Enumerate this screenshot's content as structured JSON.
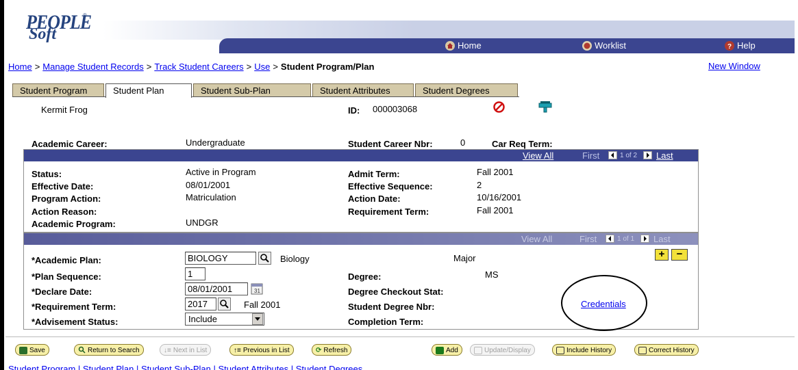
{
  "header": {
    "logo_top": "PEOPLE",
    "logo_bottom": "Soft",
    "logo_mark": "®",
    "nav": [
      {
        "label": "Home",
        "icon": "home-icon",
        "color": "#c0392b"
      },
      {
        "label": "Worklist",
        "icon": "worklist-icon",
        "color": "#c0392b"
      },
      {
        "label": "Help",
        "icon": "help-icon",
        "color": "#c0392b"
      }
    ]
  },
  "breadcrumb": {
    "items": [
      "Home",
      "Manage Student Records",
      "Track Student Careers",
      "Use"
    ],
    "current": "Student Program/Plan",
    "separator": ">"
  },
  "new_window": "New Window",
  "tabs": [
    {
      "label": "Student Program",
      "active": false
    },
    {
      "label": "Student Plan",
      "active": true
    },
    {
      "label": "Student Sub-Plan",
      "active": false
    },
    {
      "label": "Student Attributes",
      "active": false
    },
    {
      "label": "Student Degrees",
      "active": false
    }
  ],
  "student": {
    "name": "Kermit Frog",
    "id_label": "ID:",
    "id_value": "000003068"
  },
  "career": {
    "academic_career_label": "Academic Career:",
    "academic_career_value": "Undergraduate",
    "career_nbr_label": "Student Career Nbr:",
    "career_nbr_value": "0",
    "car_req_term_label": "Car Req Term:"
  },
  "program_bar": {
    "view_all": "View All",
    "first": "First",
    "range": "1 of 2",
    "last": "Last"
  },
  "program": {
    "status_label": "Status:",
    "status_value": "Active in Program",
    "effdate_label": "Effective Date:",
    "effdate_value": "08/01/2001",
    "action_label": "Program Action:",
    "action_value": "Matriculation",
    "reason_label": "Action Reason:",
    "acad_prog_label": "Academic Program:",
    "acad_prog_value": "UNDGR",
    "admit_term_label": "Admit Term:",
    "admit_term_value": "Fall 2001",
    "effseq_label": "Effective Sequence:",
    "effseq_value": "2",
    "action_date_label": "Action Date:",
    "action_date_value": "10/16/2001",
    "req_term_label": "Requirement Term:",
    "req_term_value": "Fall 2001"
  },
  "plan_bar": {
    "view_all": "View All",
    "first": "First",
    "range": "1 of 1",
    "last": "Last"
  },
  "plan": {
    "acad_plan_label": "*Academic Plan:",
    "acad_plan_value": "BIOLOGY",
    "acad_plan_desc": "Biology",
    "plan_type": "Major",
    "plan_seq_label": "*Plan Sequence:",
    "plan_seq_value": "1",
    "declare_label": "*Declare Date:",
    "declare_value": "08/01/2001",
    "req_term_label": "*Requirement Term:",
    "req_term_value": "2017",
    "req_term_desc": "Fall 2001",
    "advise_label": "*Advisement Status:",
    "advise_value": "Include",
    "degree_label": "Degree:",
    "degree_value": "MS",
    "checkout_label": "Degree Checkout Stat:",
    "degree_nbr_label": "Student Degree Nbr:",
    "completion_label": "Completion Term:",
    "credentials": "Credentials",
    "add_row": "+",
    "delete_row": "−"
  },
  "buttons": [
    {
      "label": "Save",
      "icon": "save-icon",
      "disabled": false
    },
    {
      "label": "Return to Search",
      "icon": "search-icon",
      "disabled": false
    },
    {
      "label": "Next in List",
      "icon": "next-icon",
      "disabled": true
    },
    {
      "label": "Previous in List",
      "icon": "previous-icon",
      "disabled": false
    },
    {
      "label": "Refresh",
      "icon": "refresh-icon",
      "disabled": false
    },
    {
      "label": "Add",
      "icon": "add-icon",
      "disabled": false
    },
    {
      "label": "Update/Display",
      "icon": "update-icon",
      "disabled": true
    },
    {
      "label": "Include History",
      "icon": "history-icon",
      "disabled": false
    },
    {
      "label": "Correct History",
      "icon": "correct-icon",
      "disabled": false
    }
  ],
  "footer_links": [
    "Student Program",
    "Student Plan",
    "Student Sub-Plan",
    "Student Attributes",
    "Student Degrees"
  ],
  "colors": {
    "nav_bar": "#3b4590",
    "tab_inactive": "#d4caa9",
    "button_fill": "#f7f0a8",
    "link": "#0000ee"
  }
}
